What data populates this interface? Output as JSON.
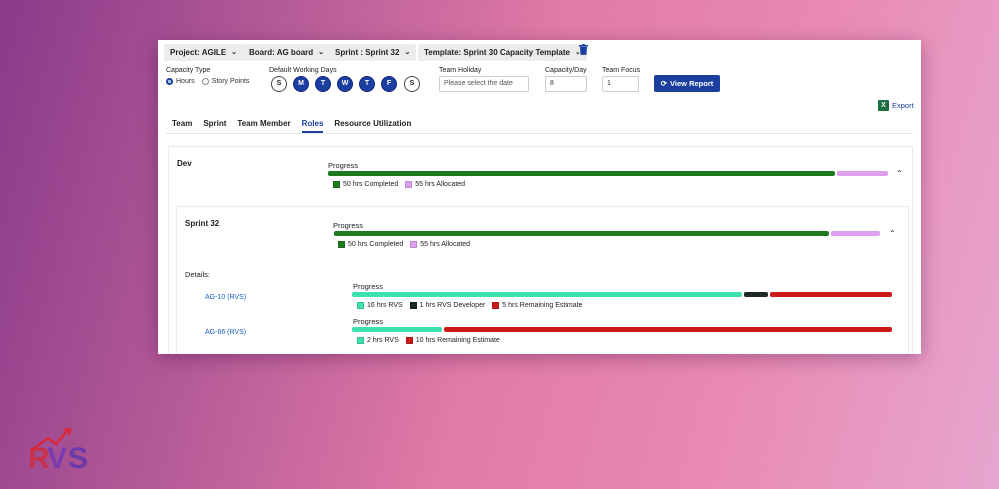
{
  "toolbar": {
    "project": "Project: AGILE",
    "board": "Board: AG board",
    "sprint": "Sprint : Sprint 32",
    "template": "Template: Sprint 30 Capacity Template"
  },
  "settings": {
    "capacity_type_label": "Capacity Type",
    "hours_label": "Hours",
    "story_points_label": "Story Points",
    "working_days_label": "Default Working Days",
    "days": [
      {
        "letter": "S",
        "active": false
      },
      {
        "letter": "M",
        "active": true
      },
      {
        "letter": "T",
        "active": true
      },
      {
        "letter": "W",
        "active": true
      },
      {
        "letter": "T",
        "active": true
      },
      {
        "letter": "F",
        "active": true
      },
      {
        "letter": "S",
        "active": false
      }
    ],
    "team_holiday_label": "Team Holiday",
    "team_holiday_placeholder": "Please select the date",
    "capacity_day_label": "Capacity/Day",
    "capacity_day_value": "8",
    "team_focus_label": "Team Focus",
    "team_focus_value": "1",
    "view_report": "View Report",
    "export": "Export"
  },
  "tabs": [
    "Team",
    "Sprint",
    "Team Member",
    "Roles",
    "Resource Utilization"
  ],
  "active_tab": "Roles",
  "colors": {
    "completed": "#1e7a1e",
    "allocated": "#dda0ee",
    "rvs": "#3ee0b0",
    "developer": "#1a2a20",
    "remaining": "#cc1a1a",
    "accent": "#1a3fa0"
  },
  "role": {
    "name": "Dev",
    "progress_label": "Progress",
    "completed_hrs": 50,
    "allocated_hrs": 55,
    "legend_completed": "50 hrs Completed",
    "legend_allocated": "55 hrs Allocated"
  },
  "sprint": {
    "name": "Sprint 32",
    "progress_label": "Progress",
    "completed_hrs": 50,
    "allocated_hrs": 55,
    "legend_completed": "50 hrs Completed",
    "legend_allocated": "55 hrs Allocated",
    "details_label": "Details:",
    "issues": [
      {
        "key": "AG-10 (RVS)",
        "progress_label": "Progress",
        "rvs_hrs": 16,
        "dev_hrs": 1,
        "remaining_hrs": 5,
        "legend_rvs": "16 hrs RVS",
        "legend_dev": "1 hrs RVS Developer",
        "legend_remaining": "5 hrs Remaining Estimate"
      },
      {
        "key": "AG-66 (RVS)",
        "progress_label": "Progress",
        "rvs_hrs": 2,
        "remaining_hrs": 10,
        "legend_rvs": "2 hrs RVS",
        "legend_remaining": "10 hrs Remaining Estimate"
      }
    ]
  },
  "brand": {
    "logo_text": "RVS"
  }
}
